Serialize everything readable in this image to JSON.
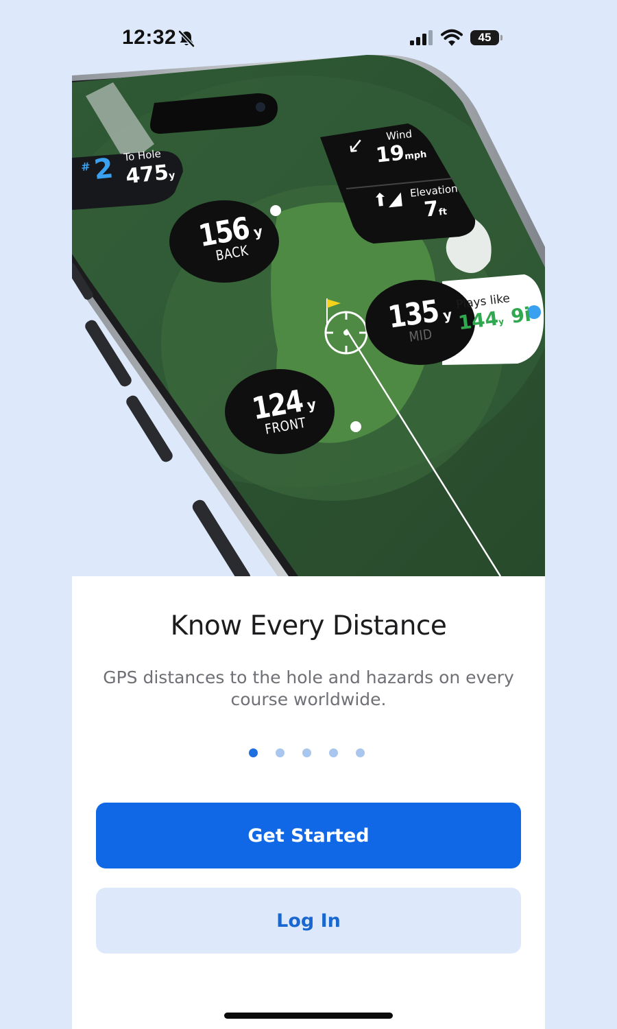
{
  "status_bar": {
    "time": "12:32",
    "battery_level": "45",
    "icons": [
      "bell-slash-icon",
      "cellular-signal-icon",
      "wifi-icon",
      "battery-icon"
    ]
  },
  "hero": {
    "to_hole": {
      "label": "To Hole",
      "hole_prefix": "#",
      "hole_number": "2",
      "distance": "475",
      "unit": "y"
    },
    "wind": {
      "label": "Wind",
      "value": "19",
      "unit": "mph"
    },
    "elevation": {
      "label": "Elevation",
      "value": "7",
      "unit": "ft"
    },
    "back": {
      "value": "156",
      "unit": "y",
      "label": "BACK"
    },
    "mid": {
      "value": "135",
      "unit": "y",
      "label": "MID"
    },
    "front": {
      "value": "124",
      "unit": "y",
      "label": "FRONT"
    },
    "plays_like": {
      "label": "Plays like",
      "value": "144",
      "unit": "y",
      "club": "9i"
    }
  },
  "card": {
    "title": "Know Every Distance",
    "subtitle": "GPS distances to the hole and hazards on every course worldwide.",
    "pagination": {
      "total": 5,
      "active_index": 0
    },
    "primary_button": "Get Started",
    "secondary_button": "Log In"
  },
  "colors": {
    "background": "#dde9fb",
    "primary": "#1168e6",
    "secondary_bg": "#dde9fb",
    "secondary_text": "#1a67cf",
    "dot_active": "#1f6fe0",
    "dot_inactive": "#a9c6ee",
    "plays_like_green": "#2fa84f",
    "accent_blue": "#3aa0f0"
  }
}
